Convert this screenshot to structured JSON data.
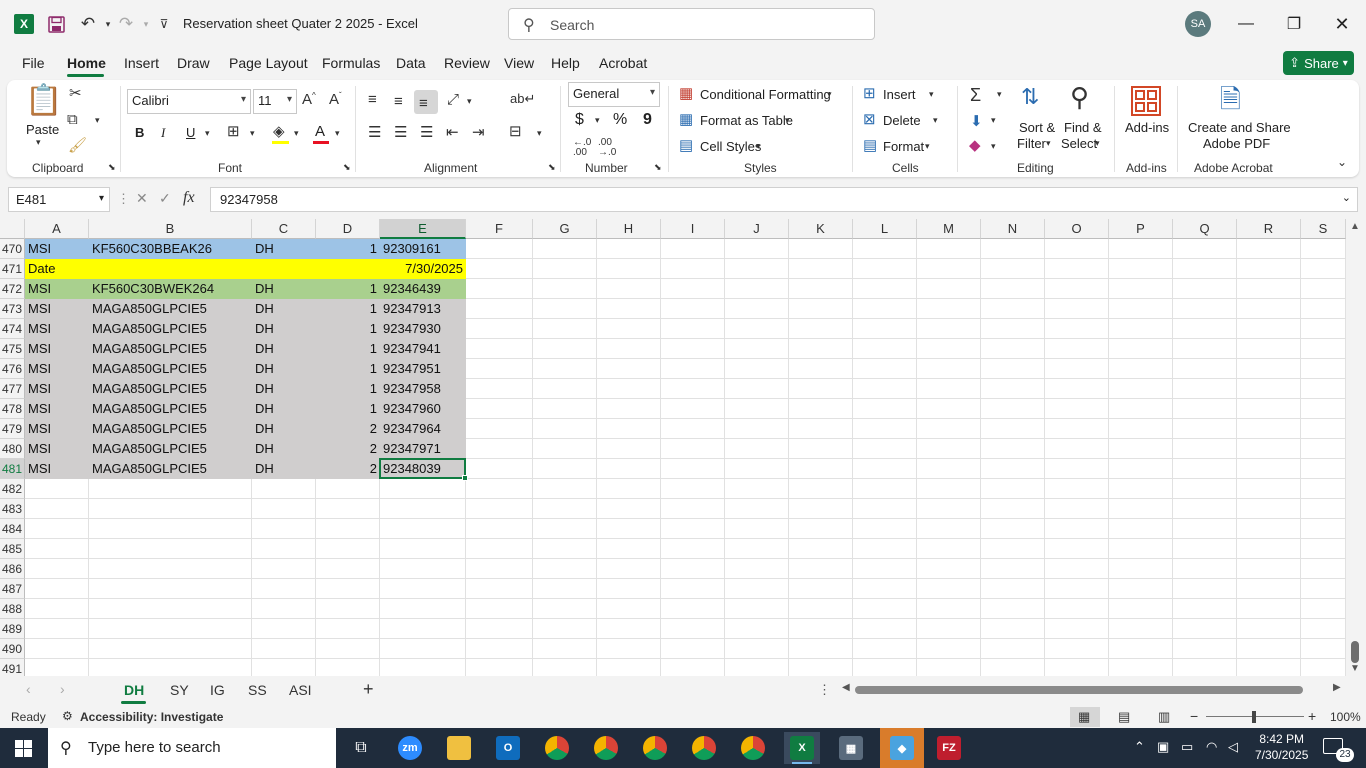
{
  "window": {
    "title": "Reservation sheet Quater 2 2025  -  Excel",
    "search_placeholder": "Search",
    "user_initials": "SA"
  },
  "menu": [
    "File",
    "Home",
    "Insert",
    "Draw",
    "Page Layout",
    "Formulas",
    "Data",
    "Review",
    "View",
    "Help",
    "Acrobat"
  ],
  "share_label": "Share",
  "ribbon": {
    "clipboard": {
      "label": "Clipboard",
      "paste": "Paste"
    },
    "font": {
      "label": "Font",
      "name": "Calibri",
      "size": "11",
      "bold": "B",
      "italic": "I",
      "underline": "U"
    },
    "alignment": {
      "label": "Alignment"
    },
    "number": {
      "label": "Number",
      "format": "General",
      "currency": "$",
      "percent": "%",
      "comma": "9"
    },
    "styles": {
      "label": "Styles",
      "conditional": "Conditional Formatting",
      "format_table": "Format as Table",
      "cell_styles": "Cell Styles"
    },
    "cells": {
      "label": "Cells",
      "insert": "Insert",
      "delete": "Delete",
      "format": "Format"
    },
    "editing": {
      "label": "Editing",
      "sort_1": "Sort &",
      "sort_2": "Filter",
      "find_1": "Find &",
      "find_2": "Select"
    },
    "addins": {
      "label": "Add-ins",
      "btn": "Add-ins"
    },
    "acrobat": {
      "label": "Adobe Acrobat",
      "btn_1": "Create and Share",
      "btn_2": "Adobe PDF"
    }
  },
  "formula_bar": {
    "name_box": "E481",
    "formula": "92347958"
  },
  "columns": [
    "A",
    "B",
    "C",
    "D",
    "E",
    "F",
    "G",
    "H",
    "I",
    "J",
    "K",
    "L",
    "M",
    "N",
    "O",
    "P",
    "Q",
    "R",
    "S"
  ],
  "rows": [
    {
      "n": "470",
      "style": "blue",
      "a": "MSI",
      "b": "KF560C30BBEAK26",
      "c": "DH",
      "d": "1",
      "e": "92309161"
    },
    {
      "n": "471",
      "style": "yellow",
      "a": "Date",
      "b": "",
      "c": "",
      "d": "",
      "e": "7/30/2025"
    },
    {
      "n": "472",
      "style": "green",
      "a": "MSI",
      "b": "KF560C30BWEK264",
      "c": "DH",
      "d": "1",
      "e": "92346439"
    },
    {
      "n": "473",
      "style": "gray",
      "a": "MSI",
      "b": "MAGA850GLPCIE5",
      "c": "DH",
      "d": "1",
      "e": "92347913"
    },
    {
      "n": "474",
      "style": "gray",
      "a": "MSI",
      "b": "MAGA850GLPCIE5",
      "c": "DH",
      "d": "1",
      "e": "92347930"
    },
    {
      "n": "475",
      "style": "gray",
      "a": "MSI",
      "b": "MAGA850GLPCIE5",
      "c": "DH",
      "d": "1",
      "e": "92347941"
    },
    {
      "n": "476",
      "style": "gray",
      "a": "MSI",
      "b": "MAGA850GLPCIE5",
      "c": "DH",
      "d": "1",
      "e": "92347951"
    },
    {
      "n": "477",
      "style": "gray",
      "a": "MSI",
      "b": "MAGA850GLPCIE5",
      "c": "DH",
      "d": "1",
      "e": "92347958"
    },
    {
      "n": "478",
      "style": "gray",
      "a": "MSI",
      "b": "MAGA850GLPCIE5",
      "c": "DH",
      "d": "1",
      "e": "92347960"
    },
    {
      "n": "479",
      "style": "gray",
      "a": "MSI",
      "b": "MAGA850GLPCIE5",
      "c": "DH",
      "d": "2",
      "e": "92347964"
    },
    {
      "n": "480",
      "style": "gray",
      "a": "MSI",
      "b": "MAGA850GLPCIE5",
      "c": "DH",
      "d": "2",
      "e": "92347971"
    },
    {
      "n": "481",
      "style": "gray",
      "a": "MSI",
      "b": "MAGA850GLPCIE5",
      "c": "DH",
      "d": "2",
      "e": "92348039"
    },
    {
      "n": "482",
      "style": "none",
      "a": "",
      "b": "",
      "c": "",
      "d": "",
      "e": ""
    },
    {
      "n": "483",
      "style": "none",
      "a": "",
      "b": "",
      "c": "",
      "d": "",
      "e": ""
    },
    {
      "n": "484",
      "style": "none",
      "a": "",
      "b": "",
      "c": "",
      "d": "",
      "e": ""
    },
    {
      "n": "485",
      "style": "none",
      "a": "",
      "b": "",
      "c": "",
      "d": "",
      "e": ""
    },
    {
      "n": "486",
      "style": "none",
      "a": "",
      "b": "",
      "c": "",
      "d": "",
      "e": ""
    },
    {
      "n": "487",
      "style": "none",
      "a": "",
      "b": "",
      "c": "",
      "d": "",
      "e": ""
    },
    {
      "n": "488",
      "style": "none",
      "a": "",
      "b": "",
      "c": "",
      "d": "",
      "e": ""
    },
    {
      "n": "489",
      "style": "none",
      "a": "",
      "b": "",
      "c": "",
      "d": "",
      "e": ""
    },
    {
      "n": "490",
      "style": "none",
      "a": "",
      "b": "",
      "c": "",
      "d": "",
      "e": ""
    },
    {
      "n": "491",
      "style": "none",
      "a": "",
      "b": "",
      "c": "",
      "d": "",
      "e": ""
    }
  ],
  "fill_colors": {
    "blue": "#9dc3e6",
    "yellow": "#ffff00",
    "green": "#a9d08e",
    "gray": "#d0cece"
  },
  "sheets": [
    "DH",
    "SY",
    "IG",
    "SS",
    "ASI"
  ],
  "status": {
    "ready": "Ready",
    "accessibility": "Accessibility: Investigate",
    "zoom": "100%"
  },
  "taskbar": {
    "search_placeholder": "Type here to search",
    "time": "8:42 PM",
    "date": "7/30/2025",
    "notifications": "23"
  }
}
